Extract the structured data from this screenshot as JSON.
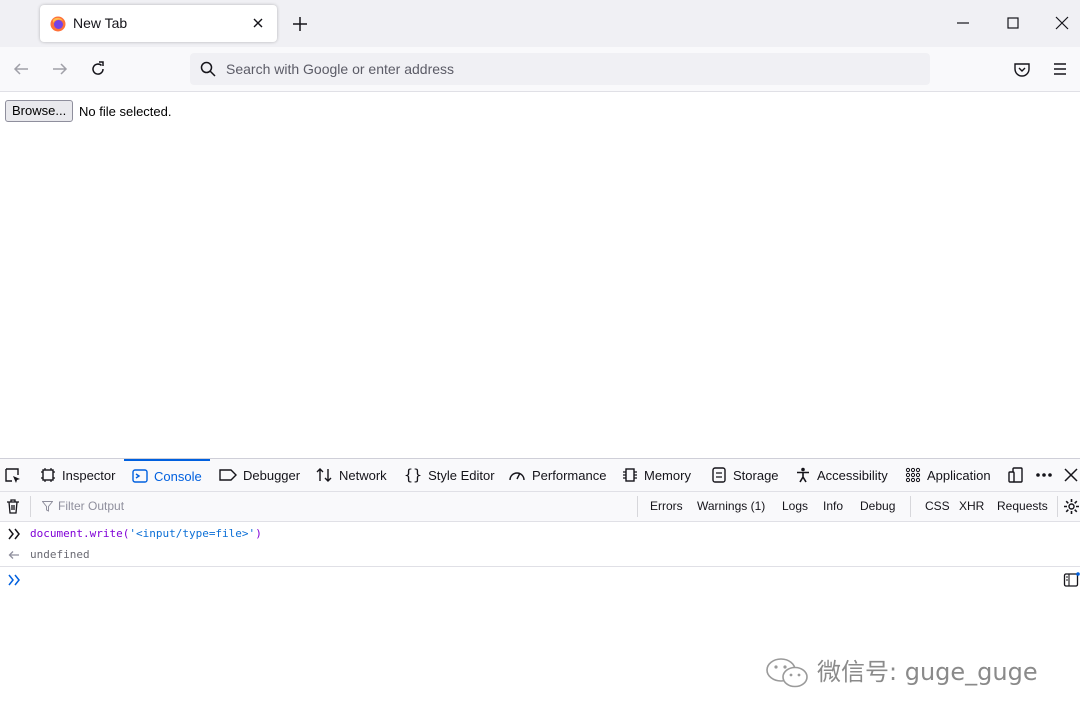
{
  "tab": {
    "title": "New Tab"
  },
  "urlbar": {
    "placeholder": "Search with Google or enter address"
  },
  "page": {
    "browse_label": "Browse...",
    "file_status": "No file selected."
  },
  "devtools": {
    "tabs": [
      {
        "label": "Inspector"
      },
      {
        "label": "Console"
      },
      {
        "label": "Debugger"
      },
      {
        "label": "Network"
      },
      {
        "label": "Style Editor"
      },
      {
        "label": "Performance"
      },
      {
        "label": "Memory"
      },
      {
        "label": "Storage"
      },
      {
        "label": "Accessibility"
      },
      {
        "label": "Application"
      }
    ],
    "selected_tab": "Console",
    "filter_placeholder": "Filter Output",
    "filters": {
      "errors": "Errors",
      "warnings": "Warnings (1)",
      "logs": "Logs",
      "info": "Info",
      "debug": "Debug",
      "css": "CSS",
      "xhr": "XHR",
      "requests": "Requests"
    },
    "console": {
      "input_code_prefix": "document.write(",
      "input_code_string": "'<input/type=file>'",
      "input_code_suffix": ")",
      "result": "undefined"
    }
  },
  "watermark": "微信号: guge_guge",
  "colors": {
    "accent": "#0060df",
    "toolbar": "#f9f9fb",
    "tabstrip": "#f0f0f4"
  }
}
